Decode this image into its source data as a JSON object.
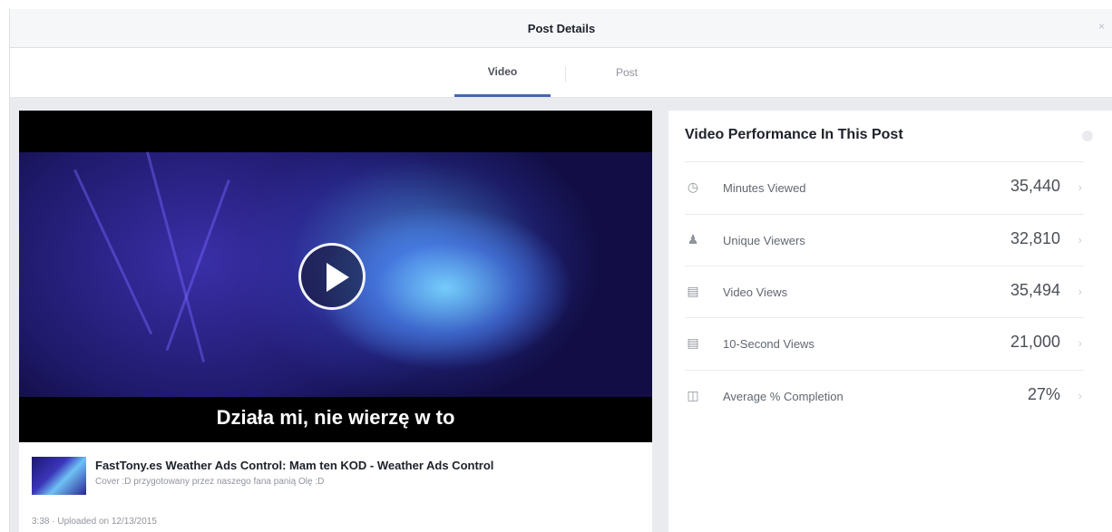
{
  "dialog": {
    "title": "Post Details",
    "close_glyph": "×"
  },
  "tabs": [
    {
      "label": "Video",
      "active": true
    },
    {
      "label": "Post",
      "active": false
    }
  ],
  "video": {
    "subtitle": "Działa mi, nie wierzę w to",
    "title": "FastTony.es Weather Ads Control: Mam ten KOD - Weather Ads Control",
    "description": "Cover :D przygotowany przez naszego fana panią Olę :D",
    "meta": "3:38 · Uploaded on 12/13/2015"
  },
  "performance": {
    "title": "Video Performance In This Post",
    "metrics": [
      {
        "icon": "clock-icon",
        "glyph": "◷",
        "label": "Minutes Viewed",
        "value": "35,440"
      },
      {
        "icon": "person-icon",
        "glyph": "♟",
        "label": "Unique Viewers",
        "value": "32,810"
      },
      {
        "icon": "video-views-icon",
        "glyph": "▤",
        "label": "Video Views",
        "value": "35,494"
      },
      {
        "icon": "ten-second-views-icon",
        "glyph": "▤",
        "label": "10-Second Views",
        "value": "21,000"
      },
      {
        "icon": "completion-icon",
        "glyph": "◫",
        "label": "Average % Completion",
        "value": "27%"
      }
    ],
    "chevron": "›"
  },
  "colors": {
    "accent": "#4267b2",
    "page_bg": "#e9ebee",
    "header_bg": "#f6f7f9"
  }
}
